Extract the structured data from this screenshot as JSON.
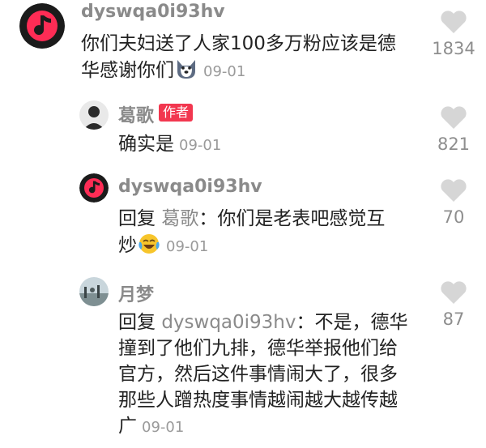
{
  "comments": [
    {
      "username": "dyswqa0i93hv",
      "text_line1": "你们夫妇送了人家100多万粉应该是德",
      "text_line2": "华感谢你们",
      "date": "09-01",
      "likes": "1834"
    },
    {
      "username": "葛歌",
      "badge": "作者",
      "text": "确实是",
      "date": "09-01",
      "likes": "821"
    },
    {
      "username": "dyswqa0i93hv",
      "reply_prefix": "回复 ",
      "reply_to": "葛歌",
      "text_line1": "：你们是老表吧感觉互",
      "text_line2": "炒",
      "date": "09-01",
      "likes": "70"
    },
    {
      "username": "月梦",
      "reply_prefix": "回复 ",
      "reply_to": "dyswqa0i93hv",
      "text_line1": "：不是，德华",
      "text_line2": "撞到了他们九排，德华举报他们给",
      "text_line3": "官方，然后这件事情闹大了，很多",
      "text_line4": "那些人蹭热度事情越闹越大越传越",
      "text_line5": "广",
      "date": "09-01",
      "likes": "87"
    }
  ],
  "icons": {
    "like": "heart-icon",
    "emoji_1": "husky-dog-emoji",
    "emoji_2": "laughing-crying-emoji"
  },
  "colors": {
    "accent": "#f2374f",
    "muted": "#8a8a8a",
    "heart": "#d6d6d6"
  }
}
